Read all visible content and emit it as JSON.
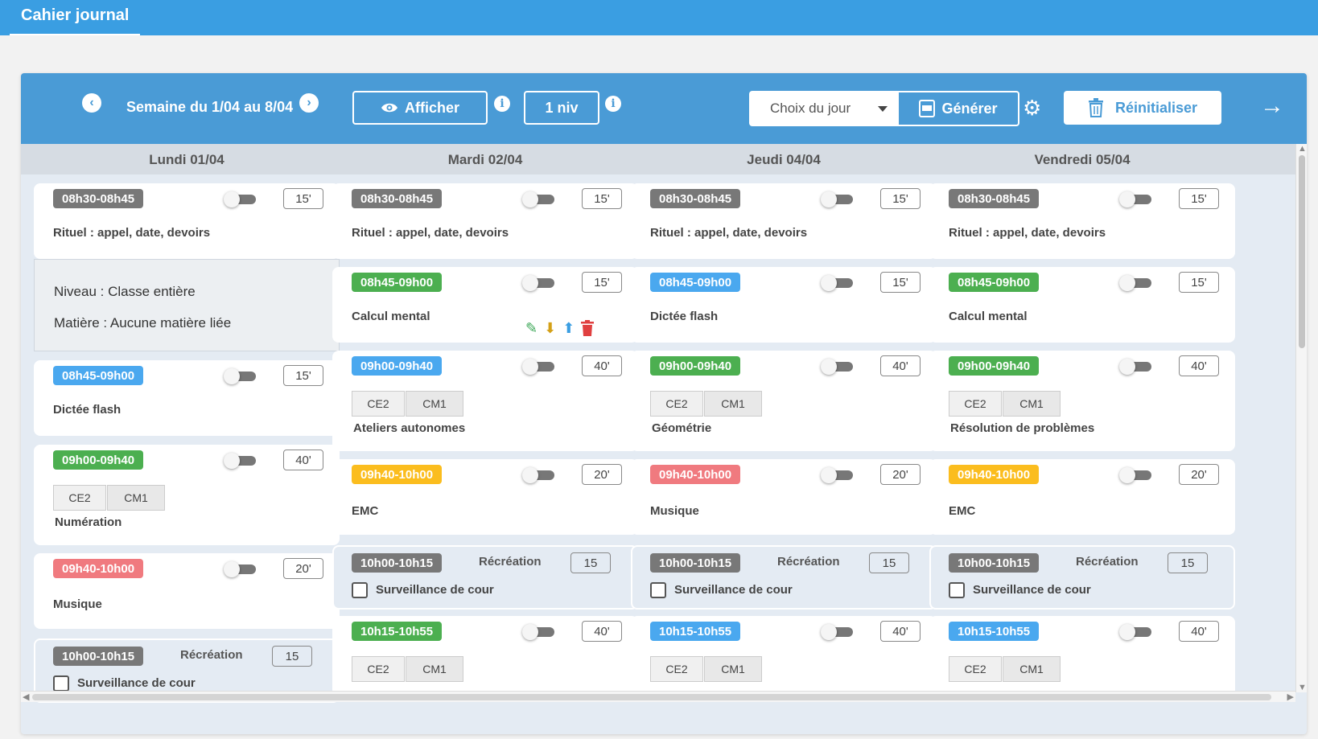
{
  "app": {
    "tab_title": "Cahier journal"
  },
  "toolbar": {
    "week_label": "Semaine du 1/04 au 8/04",
    "afficher_label": "Afficher",
    "niveau_label": "1 niv",
    "day_select_value": "Choix du jour",
    "generate_label": "Générer",
    "reset_label": "Réinitialiser"
  },
  "days": [
    {
      "label": "Lundi 01/04"
    },
    {
      "label": "Mardi 02/04"
    },
    {
      "label": "Jeudi 04/04"
    },
    {
      "label": "Vendredi 05/04"
    }
  ],
  "info_panel": {
    "niveau": "Niveau : Classe entière",
    "matiere": "Matière : Aucune matière liée"
  },
  "levels": {
    "a": "CE2",
    "b": "CM1"
  },
  "recreation": {
    "label": "Récréation",
    "check_label": "Surveillance de cour"
  },
  "columns": [
    {
      "cards": [
        {
          "time": "08h30-08h45",
          "duration": "15'",
          "title": "Rituel : appel, date, devoirs"
        },
        {
          "time": "08h45-09h00",
          "duration": "15'",
          "title": "Dictée flash"
        },
        {
          "time": "09h00-09h40",
          "duration": "40'",
          "title": "Numération"
        },
        {
          "time": "09h40-10h00",
          "duration": "20'",
          "title": "Musique"
        },
        {
          "time": "10h00-10h15",
          "duration": "15"
        }
      ]
    },
    {
      "cards": [
        {
          "time": "08h30-08h45",
          "duration": "15'",
          "title": "Rituel : appel, date, devoirs"
        },
        {
          "time": "08h45-09h00",
          "duration": "15'",
          "title": "Calcul mental"
        },
        {
          "time": "09h00-09h40",
          "duration": "40'",
          "title": "Ateliers autonomes"
        },
        {
          "time": "09h40-10h00",
          "duration": "20'",
          "title": "EMC"
        },
        {
          "time": "10h00-10h15",
          "duration": "15"
        },
        {
          "time": "10h15-10h55",
          "duration": "40'"
        }
      ]
    },
    {
      "cards": [
        {
          "time": "08h30-08h45",
          "duration": "15'",
          "title": "Rituel : appel, date, devoirs"
        },
        {
          "time": "08h45-09h00",
          "duration": "15'",
          "title": "Dictée flash"
        },
        {
          "time": "09h00-09h40",
          "duration": "40'",
          "title": "Géométrie"
        },
        {
          "time": "09h40-10h00",
          "duration": "20'",
          "title": "Musique"
        },
        {
          "time": "10h00-10h15",
          "duration": "15"
        },
        {
          "time": "10h15-10h55",
          "duration": "40'"
        }
      ]
    },
    {
      "cards": [
        {
          "time": "08h30-08h45",
          "duration": "15'",
          "title": "Rituel : appel, date, devoirs"
        },
        {
          "time": "08h45-09h00",
          "duration": "15'",
          "title": "Calcul mental"
        },
        {
          "time": "09h00-09h40",
          "duration": "40'",
          "title": "Résolution de problèmes"
        },
        {
          "time": "09h40-10h00",
          "duration": "20'",
          "title": "EMC"
        },
        {
          "time": "10h00-10h15",
          "duration": "15"
        },
        {
          "time": "10h15-10h55",
          "duration": "40'"
        }
      ]
    }
  ],
  "colors": {
    "header_blue": "#3a9ee2",
    "toolbar_blue": "#4a9bd6",
    "badge_grey": "#787878",
    "badge_blue": "#4aa8ef",
    "badge_green": "#4caf50",
    "badge_yellow": "#fbbd1e",
    "badge_pink": "#f07a7f"
  }
}
